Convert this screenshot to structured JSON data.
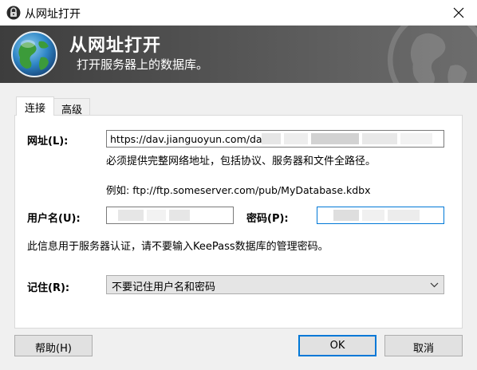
{
  "window": {
    "title": "从网址打开",
    "close_symbol": "✕"
  },
  "banner": {
    "title": "从网址打开",
    "subtitle": "打开服务器上的数据库。"
  },
  "tabs": [
    {
      "label": "连接",
      "active": true
    },
    {
      "label": "高级",
      "active": false
    }
  ],
  "form": {
    "url_label": "网址",
    "url_shortcut": "(L):",
    "url_value": "https://dav.jianguoyun.com/dav/",
    "url_hint": "必须提供完整网络地址，包括协议、服务器和文件全路径。",
    "example_label": "例如:",
    "example_value": "ftp://ftp.someserver.com/pub/MyDatabase.kdbx",
    "username_label": "用户名",
    "username_shortcut": "(U):",
    "password_label": "密码",
    "password_shortcut": "(P):",
    "auth_note": "此信息用于服务器认证，请不要输入KeePass数据库的管理密码。",
    "remember_label": "记住",
    "remember_shortcut": "(R):",
    "remember_selected": "不要记住用户名和密码"
  },
  "buttons": {
    "help": "帮助(H)",
    "ok": "OK",
    "cancel": "取消"
  },
  "icons": {
    "app": "lock-icon",
    "banner": "globe-icon",
    "close": "close-icon",
    "dropdown": "chevron-down-icon"
  },
  "colors": {
    "focus_accent": "#0078d7",
    "banner_dark": "#3d3d3d",
    "banner_light": "#6d6d6d"
  }
}
